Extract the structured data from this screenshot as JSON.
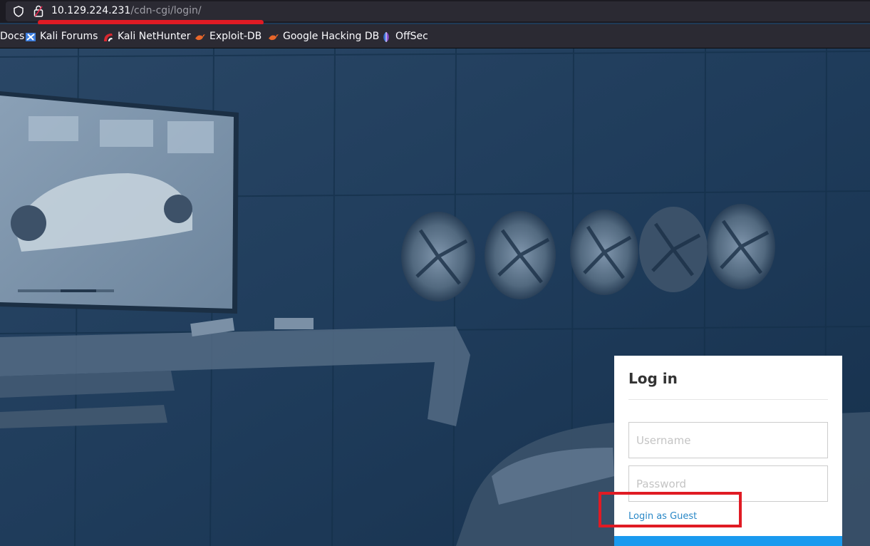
{
  "browser": {
    "url_host": "10.129.224.231",
    "url_path": "/cdn-cgi/login/",
    "bookmarks": [
      {
        "label": "Docs",
        "icon": "docs-icon"
      },
      {
        "label": "Kali Forums",
        "icon": "kali-forums-icon"
      },
      {
        "label": "Kali NetHunter",
        "icon": "kali-nethunter-icon"
      },
      {
        "label": "Exploit-DB",
        "icon": "exploit-db-icon"
      },
      {
        "label": "Google Hacking DB",
        "icon": "ghdb-icon"
      },
      {
        "label": "OffSec",
        "icon": "offsec-icon"
      }
    ]
  },
  "login": {
    "title": "Log in",
    "username_placeholder": "Username",
    "password_placeholder": "Password",
    "guest_link": "Login as Guest"
  },
  "colors": {
    "annotation_red": "#e01b24",
    "link_blue": "#2a88c7",
    "button_blue": "#1a9aef",
    "background_navy": "#1e3956"
  }
}
